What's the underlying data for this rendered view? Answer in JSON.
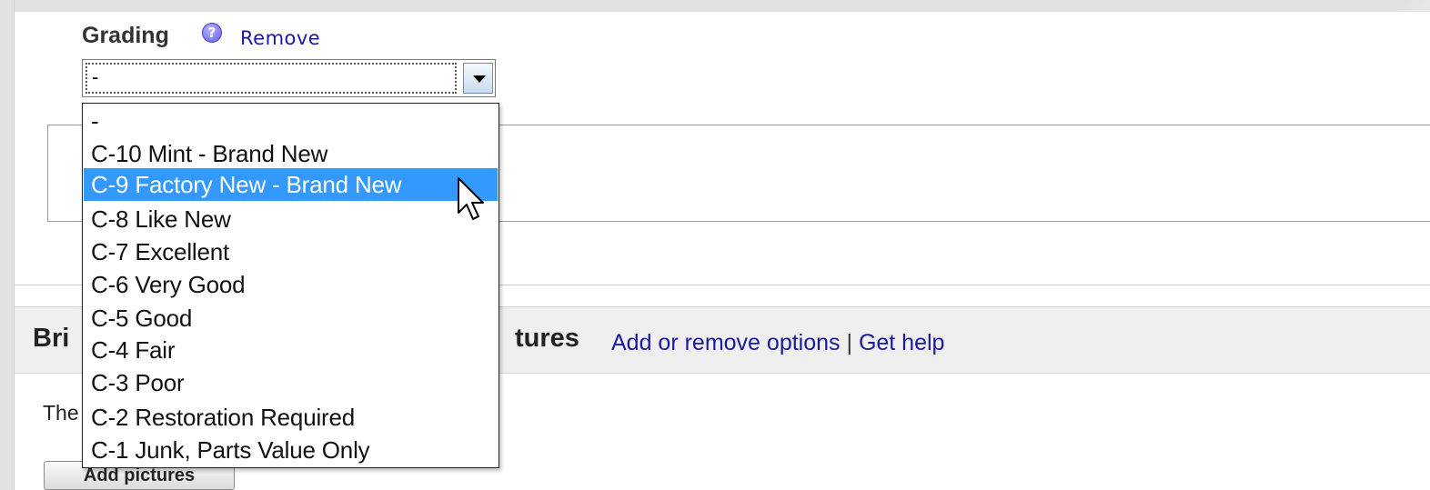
{
  "grading": {
    "label": "Grading",
    "help_glyph": "?",
    "remove_label": "Remove",
    "select_value": "-",
    "options": [
      {
        "label": "-",
        "selected": false
      },
      {
        "label": "C-10 Mint - Brand New",
        "selected": false
      },
      {
        "label": "C-9 Factory New - Brand New",
        "selected": true
      },
      {
        "label": "C-8 Like New",
        "selected": false
      },
      {
        "label": "C-7 Excellent",
        "selected": false
      },
      {
        "label": "C-6 Very Good",
        "selected": false
      },
      {
        "label": "C-5 Good",
        "selected": false
      },
      {
        "label": "C-4 Fair",
        "selected": false
      },
      {
        "label": "C-3 Poor",
        "selected": false
      },
      {
        "label": "C-2 Restoration Required",
        "selected": false
      },
      {
        "label": "C-1 Junk, Parts Value Only",
        "selected": false
      }
    ]
  },
  "section": {
    "title_visible_start": "Bri",
    "title_visible_end": "tures",
    "add_remove_link": "Add or remove options",
    "separator": "|",
    "help_link": "Get help"
  },
  "body": {
    "text_visible_start": "The",
    "add_pictures_label": "Add pictures"
  },
  "colors": {
    "link": "#1a1aa0",
    "highlight": "#3399ff",
    "section_header_bg": "#efefef"
  },
  "icons": [
    "help-icon",
    "chevron-down-icon",
    "mouse-pointer-icon"
  ]
}
